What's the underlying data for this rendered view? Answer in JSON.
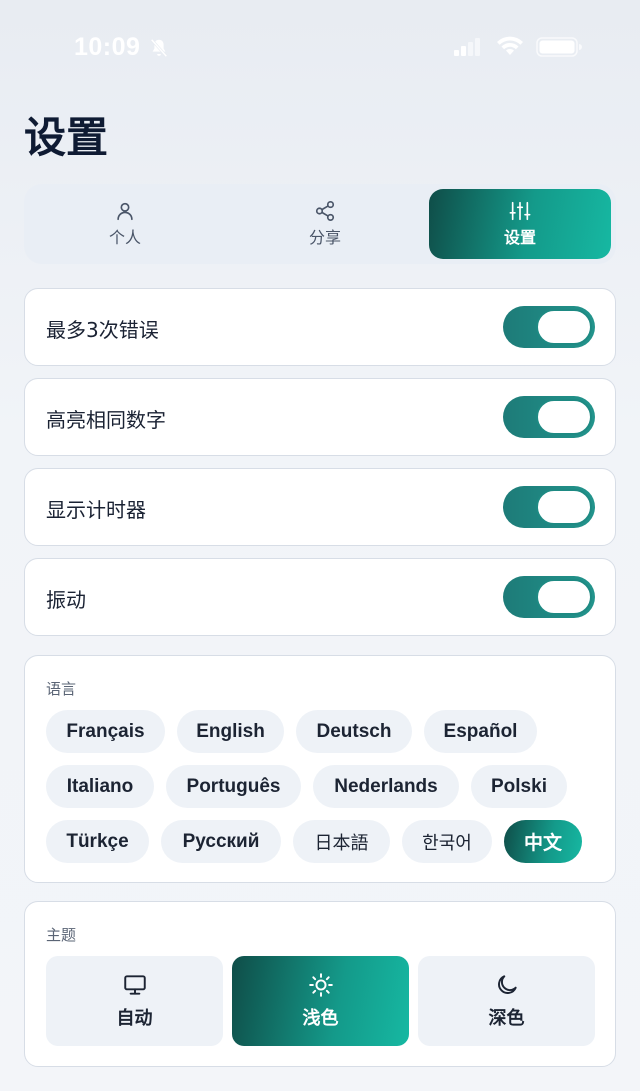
{
  "status_bar": {
    "time": "10:09"
  },
  "page": {
    "title": "设置"
  },
  "tabs": [
    {
      "label": "个人",
      "icon": "user-icon"
    },
    {
      "label": "分享",
      "icon": "share-icon"
    },
    {
      "label": "设置",
      "icon": "sliders-icon",
      "active": true
    }
  ],
  "settings": [
    {
      "label": "最多3次错误",
      "on": true
    },
    {
      "label": "高亮相同数字",
      "on": true
    },
    {
      "label": "显示计时器",
      "on": true
    },
    {
      "label": "振动",
      "on": true
    }
  ],
  "language": {
    "title": "语言",
    "options": [
      "Français",
      "English",
      "Deutsch",
      "Español",
      "Italiano",
      "Português",
      "Nederlands",
      "Polski",
      "Türkçe",
      "Русский",
      "日本語",
      "한국어",
      "中文"
    ],
    "selected": "中文"
  },
  "theme": {
    "title": "主题",
    "options": [
      {
        "label": "自动",
        "icon": "monitor-icon"
      },
      {
        "label": "浅色",
        "icon": "sun-icon",
        "active": true
      },
      {
        "label": "深色",
        "icon": "moon-icon"
      }
    ]
  },
  "colors": {
    "accent_dark": "#0f4d48",
    "accent": "#16b8a2",
    "toggle": "#1f8a84"
  }
}
